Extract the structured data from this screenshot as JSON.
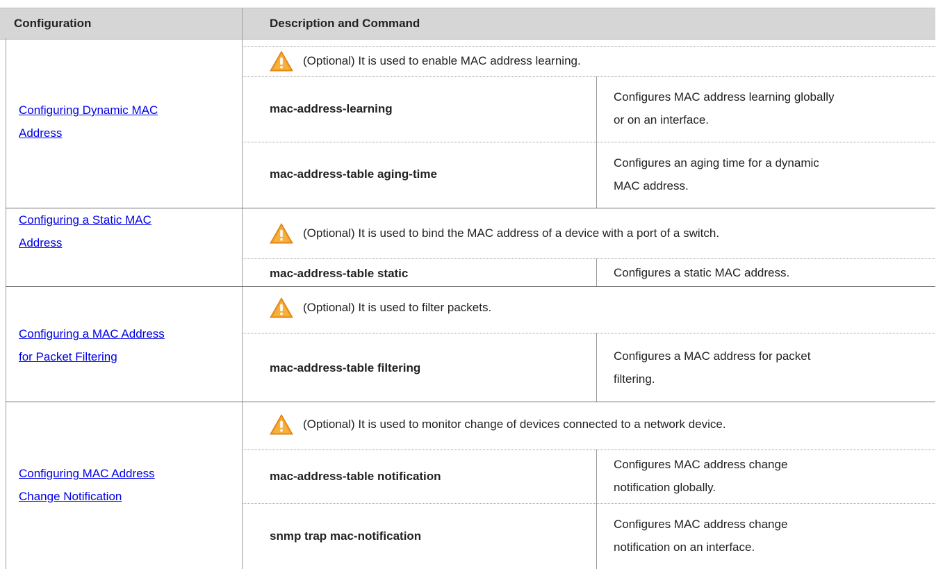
{
  "header": {
    "col1": "Configuration",
    "col2": "Description and Command"
  },
  "sections": [
    {
      "config_line1": "Configuring Dynamic MAC",
      "config_line2": "Address",
      "note": "(Optional) It is used to enable MAC address learning.",
      "commands": [
        {
          "cmd": "mac-address-learning",
          "desc1": "Configures MAC address learning globally",
          "desc2": "or on an interface."
        },
        {
          "cmd": "mac-address-table aging-time",
          "desc1": "Configures an aging time for a dynamic",
          "desc2": "MAC address."
        }
      ]
    },
    {
      "config_line1": "Configuring a Static MAC",
      "config_line2": "Address",
      "note": "(Optional) It is used to bind the MAC address of a device with a port of a switch.",
      "commands": [
        {
          "cmd": "mac-address-table static",
          "desc1": "Configures a static MAC address."
        }
      ]
    },
    {
      "config_line1": "Configuring a MAC Address",
      "config_line2": "for Packet Filtering",
      "note": "(Optional) It is used to filter packets.",
      "commands": [
        {
          "cmd": "mac-address-table filtering",
          "desc1": "Configures a MAC address for packet",
          "desc2": "filtering."
        }
      ]
    },
    {
      "config_line1": "Configuring MAC Address",
      "config_line2": "Change Notification",
      "note": "(Optional) It is used to monitor change of devices connected to a network device.",
      "commands": [
        {
          "cmd": "mac-address-table notification",
          "desc1": "Configures MAC address change",
          "desc2": "notification globally."
        },
        {
          "cmd": "snmp trap mac-notification",
          "desc1": "Configures MAC address change",
          "desc2": "notification on an interface."
        }
      ]
    }
  ],
  "icons": {
    "warning": "warning-icon"
  },
  "colors": {
    "link": "#0000e6",
    "header_bg": "#d6d6d6",
    "warning": "#f5a623"
  }
}
